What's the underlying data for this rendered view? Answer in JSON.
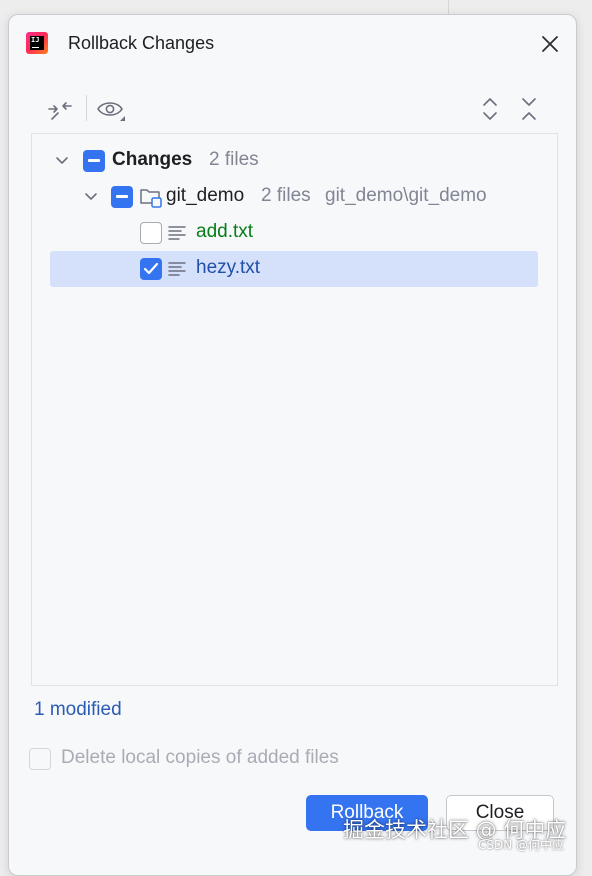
{
  "dialog": {
    "title": "Rollback Changes",
    "app_icon": "intellij-idea-icon",
    "close_icon": "close-icon"
  },
  "toolbar": {
    "left_icons": [
      "collapse-arrows-icon",
      "eye-preview-icon"
    ],
    "right_icons": [
      "expand-all-icon",
      "collapse-all-icon"
    ]
  },
  "tree": {
    "root": {
      "label": "Changes",
      "count": "2 files",
      "checkbox": "partial",
      "expanded": true
    },
    "module": {
      "label": "git_demo",
      "count": "2 files",
      "path": "git_demo\\git_demo",
      "checkbox": "partial",
      "expanded": true
    },
    "files": [
      {
        "name": "add.txt",
        "checked": false,
        "status_color": "#067d17",
        "selected": false
      },
      {
        "name": "hezy.txt",
        "checked": true,
        "status_color": "#1f4fa8",
        "selected": true
      }
    ]
  },
  "status": {
    "summary": "1 modified"
  },
  "options": {
    "delete_local_copies": {
      "label": "Delete local copies of added files",
      "checked": false,
      "enabled": false
    }
  },
  "buttons": {
    "rollback": "Rollback",
    "close": "Close"
  },
  "watermark": {
    "main": "掘金技术社区 @ 何中应",
    "small": "CSDN @何中应"
  },
  "colors": {
    "accent": "#3574f0",
    "selection": "#d5e1fb",
    "added": "#067d17",
    "modified": "#1f4fa8"
  }
}
